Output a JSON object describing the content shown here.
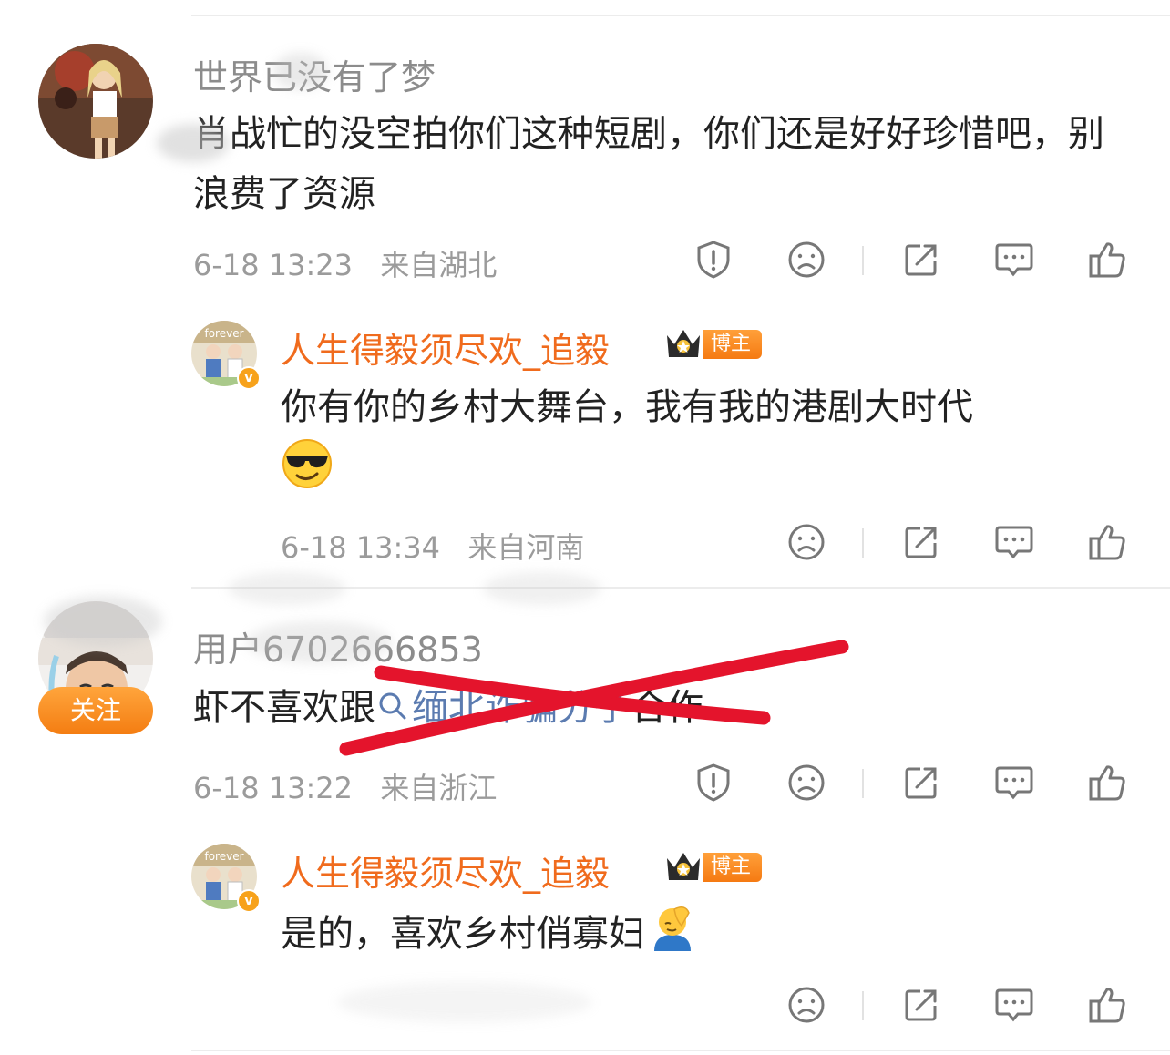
{
  "comments": [
    {
      "username": "世界已没有了梦",
      "text": "肖战忙的没空拍你们这种短剧，你们还是好好珍惜吧，别浪费了资源",
      "time": "6-18 13:23",
      "location": "来自湖北",
      "reply": {
        "username": "人生得毅须尽欢_追毅",
        "badge": "博主",
        "text": "你有你的乡村大舞台，我有我的港剧大时代",
        "time": "6-18 13:34",
        "location": "来自河南"
      }
    },
    {
      "username": "用户6702666853",
      "follow_label": "关注",
      "text_before": "虾不喜欢跟",
      "topic": "缅北诈骗分子",
      "text_after": "合作",
      "time": "6-18 13:22",
      "location": "来自浙江",
      "reply": {
        "username": "人生得毅须尽欢_追毅",
        "badge": "博主",
        "text": "是的，喜欢乡村俏寡妇",
        "time": "",
        "location": ""
      }
    }
  ],
  "icons": [
    "report-icon",
    "dislike-icon",
    "share-icon",
    "comment-icon",
    "like-icon",
    "search-icon",
    "crown-icon",
    "sunglasses-emoji",
    "facepalm-emoji"
  ],
  "colors": {
    "accent": "#f06b1d",
    "topic": "#5b7bb0",
    "meta": "#9b9b9b",
    "annotation_cross": "#e4142c"
  }
}
